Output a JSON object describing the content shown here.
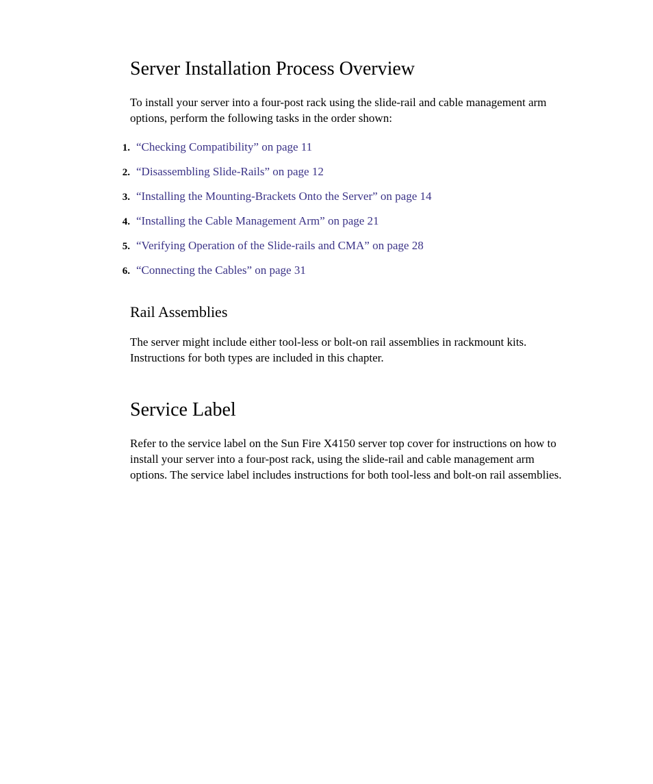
{
  "section1": {
    "title": "Server Installation Process Overview",
    "intro": "To install your server into a four-post rack using the slide-rail and cable management arm options, perform the following tasks in the order shown:",
    "steps": [
      {
        "num": "1.",
        "text": "“Checking Compatibility” on page 11"
      },
      {
        "num": "2.",
        "text": "“Disassembling Slide-Rails” on page 12"
      },
      {
        "num": "3.",
        "text": "“Installing the Mounting-Brackets Onto the Server” on page 14"
      },
      {
        "num": "4.",
        "text": "“Installing the Cable Management Arm” on page 21"
      },
      {
        "num": "5.",
        "text": "“Verifying Operation of the Slide-rails and CMA” on page 28"
      },
      {
        "num": "6.",
        "text": "“Connecting the Cables” on page 31"
      }
    ],
    "subsection": {
      "title": "Rail Assemblies",
      "body": "The server might include either tool-less or bolt-on rail assemblies in rackmount kits. Instructions for both types are included in this chapter."
    }
  },
  "section2": {
    "title": "Service Label",
    "body": "Refer to the service label on the Sun Fire X4150 server top cover for instructions on how to install your server into a four-post rack, using the slide-rail and cable management arm options. The service label includes instructions for both tool-less and bolt-on rail assemblies."
  }
}
